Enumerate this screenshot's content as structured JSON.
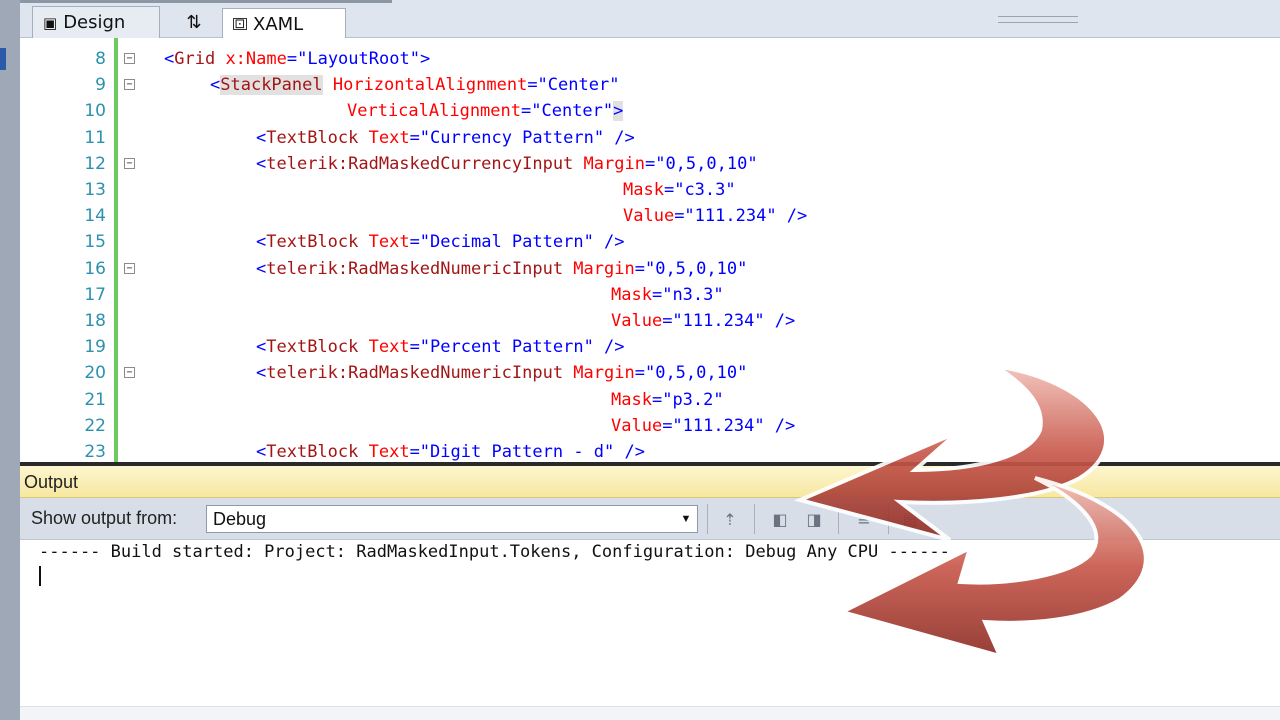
{
  "tabs": {
    "design": "Design",
    "swap": "⇅",
    "xaml": "XAML"
  },
  "editor": {
    "lines": [
      {
        "num": "8",
        "fold": "⊟"
      },
      {
        "num": "9",
        "fold": "⊟"
      },
      {
        "num": "10",
        "fold": ""
      },
      {
        "num": "11",
        "fold": ""
      },
      {
        "num": "12",
        "fold": "⊟"
      },
      {
        "num": "13",
        "fold": ""
      },
      {
        "num": "14",
        "fold": ""
      },
      {
        "num": "15",
        "fold": ""
      },
      {
        "num": "16",
        "fold": "⊟"
      },
      {
        "num": "17",
        "fold": ""
      },
      {
        "num": "18",
        "fold": ""
      },
      {
        "num": "19",
        "fold": ""
      },
      {
        "num": "20",
        "fold": "⊟"
      },
      {
        "num": "21",
        "fold": ""
      },
      {
        "num": "22",
        "fold": ""
      },
      {
        "num": "23",
        "fold": ""
      }
    ],
    "tokens": {
      "l8": [
        "<",
        "Grid",
        " x:Name",
        "=\"",
        "LayoutRoot",
        "\">"
      ],
      "l9": [
        "<",
        "StackPanel",
        " HorizontalAlignment",
        "=\"",
        "Center",
        "\""
      ],
      "l10": [
        "VerticalAlignment",
        "=\"",
        "Center",
        "\"",
        ">"
      ],
      "l11": [
        "<",
        "TextBlock",
        " Text",
        "=\"",
        "Currency Pattern",
        "\" />"
      ],
      "l12": [
        "<",
        "telerik:RadMaskedCurrencyInput",
        " Margin",
        "=\"",
        "0,5,0,10",
        "\""
      ],
      "l13": [
        "Mask",
        "=\"",
        "c3.3",
        "\""
      ],
      "l14": [
        "Value",
        "=\"",
        "111.234",
        "\" />"
      ],
      "l15": [
        "<",
        "TextBlock",
        " Text",
        "=\"",
        "Decimal Pattern",
        "\" />"
      ],
      "l16": [
        "<",
        "telerik:RadMaskedNumericInput",
        " Margin",
        "=\"",
        "0,5,0,10",
        "\""
      ],
      "l17": [
        "Mask",
        "=\"",
        "n3.3",
        "\""
      ],
      "l18": [
        "Value",
        "=\"",
        "111.234",
        "\" />"
      ],
      "l19": [
        "<",
        "TextBlock",
        " Text",
        "=\"",
        "Percent Pattern",
        "\" />"
      ],
      "l20": [
        "<",
        "telerik:RadMaskedNumericInput",
        " Margin",
        "=\"",
        "0,5,0,10",
        "\""
      ],
      "l21": [
        "Mask",
        "=\"",
        "p3.2",
        "\""
      ],
      "l22": [
        "Value",
        "=\"",
        "111.234",
        "\" />"
      ],
      "l23": [
        "<",
        "TextBlock",
        " Text",
        "=\"",
        "Digit Pattern - d",
        "\" />"
      ]
    }
  },
  "output": {
    "title": "Output",
    "show_from_label": "Show output from:",
    "source_value": "Debug",
    "log": "------ Build started: Project: RadMaskedInput.Tokens, Configuration: Debug Any CPU ------"
  },
  "colors": {
    "tag_name": "#a31515",
    "attr_name": "#ff0000",
    "attr_value": "#0000ff",
    "bracket": "#0000ff",
    "line_number": "#2b91af",
    "change_bar": "#6ccb5f",
    "output_title_bg": "#f7e7a0",
    "arrow_fill": "#c85a4e"
  },
  "icons": {
    "design_tab": "design-view-icon",
    "swap": "swap-panes-icon",
    "xaml_tab": "xaml-view-icon",
    "goto_location": "goto-location-icon",
    "prev_message": "previous-message-icon",
    "next_message": "next-message-icon",
    "clear_all": "clear-all-icon",
    "word_wrap": "word-wrap-icon"
  }
}
